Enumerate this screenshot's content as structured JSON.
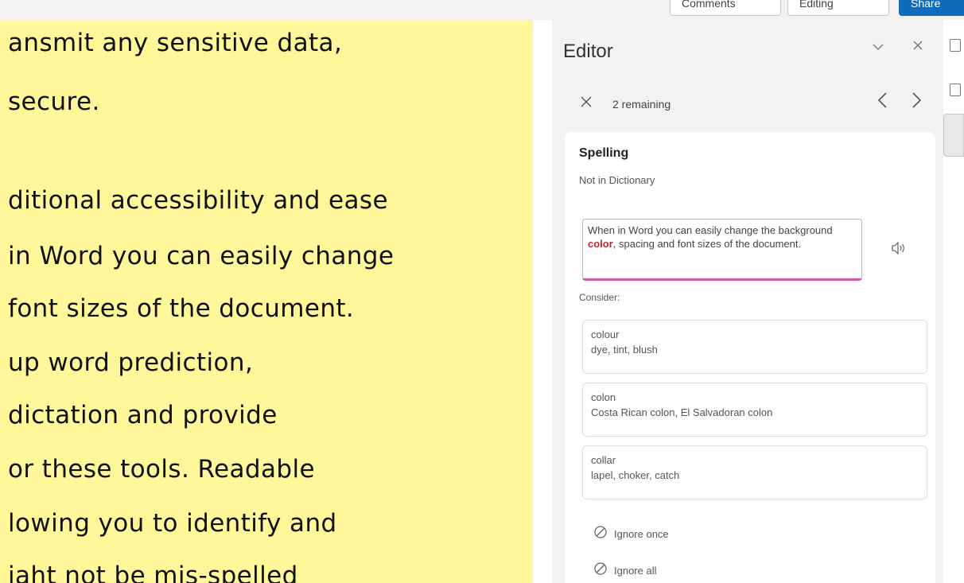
{
  "toolbar": {
    "comments_label": "Comments",
    "editing_label": "Editing",
    "share_label": "Share"
  },
  "document": {
    "lines": [
      "ansmit any sensitive data,",
      "secure.",
      "ditional accessibility and ease",
      "in Word you can easily change",
      "font sizes of the document.",
      "up word prediction,",
      "dictation and provide",
      "or these tools. Readable",
      "lowing you to identify and",
      "iaht not be mis-spelled"
    ]
  },
  "editor": {
    "title": "Editor",
    "remaining": "2 remaining",
    "card": {
      "title": "Spelling",
      "subtitle": "Not in Dictionary",
      "context_before": "When in Word you can easily change the background ",
      "context_flagged": "color",
      "context_after": ", spacing and font sizes of the document.",
      "consider_label": "Consider:",
      "suggestions": [
        {
          "word": "colour",
          "synonyms": "dye, tint, blush"
        },
        {
          "word": "colon",
          "synonyms": "Costa Rican colon, El Salvadoran colon"
        },
        {
          "word": "collar",
          "synonyms": "lapel, choker, catch"
        }
      ],
      "ignore_once": "Ignore once",
      "ignore_all": "Ignore all"
    }
  },
  "icons": {
    "collapse": "chevron-down-icon",
    "close": "close-icon",
    "prev": "chevron-left-icon",
    "next": "chevron-right-icon",
    "read_aloud": "speaker-icon",
    "ignore": "prohibited-icon"
  },
  "colors": {
    "document_background": "#fff89a",
    "flagged_word": "#c4262e",
    "context_underline": "#d35aa8",
    "share_button": "#0f6cbd"
  }
}
